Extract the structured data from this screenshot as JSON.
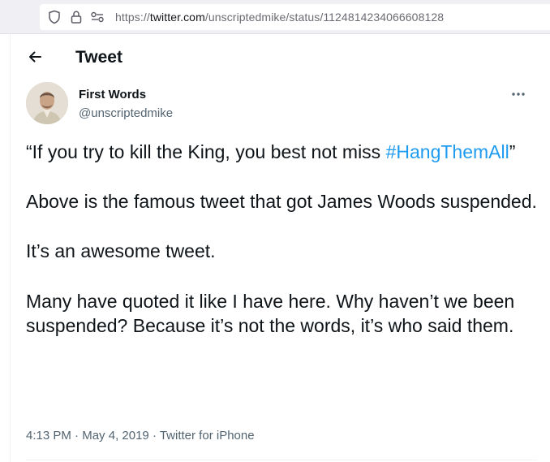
{
  "browser": {
    "url_prefix": "https://",
    "url_domain": "twitter.com",
    "url_path": "/unscriptedmike/status/1124814234066608128"
  },
  "header": {
    "title": "Tweet"
  },
  "tweet": {
    "author_name": "First Words",
    "author_handle": "@unscriptedmike",
    "quote_open": "“If you try to kill the King, you best not miss ",
    "hashtag": "#HangThemAll",
    "quote_close": "”",
    "paragraph_2": "Above is the famous tweet that got James Woods suspended.",
    "paragraph_3": "It’s an awesome tweet.",
    "paragraph_4": "Many have quoted it like I have here. Why haven’t we been suspended? Because it’s not the words, it’s who said them.",
    "time": "4:13 PM",
    "separator": " · ",
    "date": "May 4, 2019",
    "source": "Twitter for iPhone"
  },
  "colors": {
    "text": "#0f1419",
    "secondary": "#536471",
    "link": "#1d9bf0"
  }
}
